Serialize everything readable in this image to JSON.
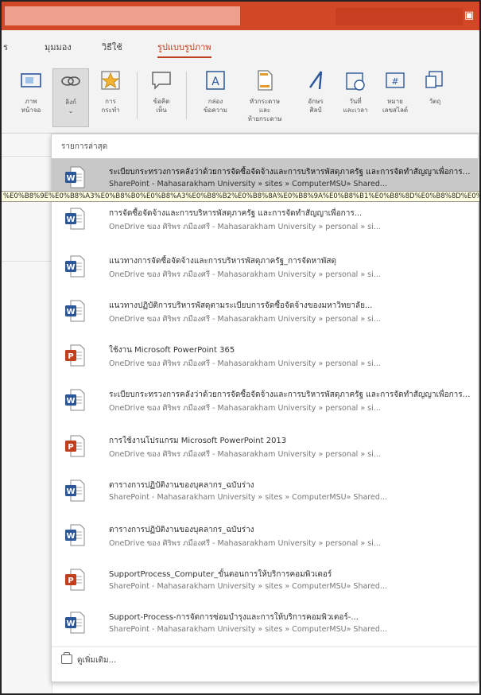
{
  "colors": {
    "accent": "#d24726",
    "word_blue": "#2b579a",
    "powerpoint_red": "#c43e1c",
    "hover_row": "#c8c8c8"
  },
  "ribbon_tabs": [
    {
      "label": "ร"
    },
    {
      "label": "มุมมอง"
    },
    {
      "label": "วิธีใช้"
    },
    {
      "label": "รูปแบบรูปภาพ"
    }
  ],
  "ribbon_buttons": [
    {
      "icon": "screenshot-icon",
      "label": "ภาพ\nหน้าจอ"
    },
    {
      "icon": "link-icon",
      "label": "ลิงก์\n⌄"
    },
    {
      "icon": "action-star-icon",
      "label": "การ\nกระทำ"
    },
    {
      "icon": "comment-icon",
      "label": "ข้อคิด\nเห็น"
    },
    {
      "icon": "textbox-icon",
      "label": "กล่อง\nข้อความ"
    },
    {
      "icon": "header-footer-icon",
      "label": "หัวกระดาษและ\nท้ายกระดาษ"
    },
    {
      "icon": "wordart-icon",
      "label": "อักษร\nศิลป์"
    },
    {
      "icon": "date-time-icon",
      "label": "วันที่\nและเวลา"
    },
    {
      "icon": "slide-number-icon",
      "label": "หมาย\nเลขสไลด์"
    },
    {
      "icon": "object-icon",
      "label": "วัตถุ"
    }
  ],
  "dropdown": {
    "header": "รายการล่าสุด",
    "url_tooltip": "%E0%B8%9E%E0%B8%A3%E0%B8%B0%E0%B8%A3%E0%B8%B2%E0%B8%8A%E0%B8%9A%E0%B8%B1%E0%B8%8D%E0%B8%8D%E0%B8%B1%E0%B8%95%E0%B8%B4%20%E0%B8%9E%E0%B8%A3%E0%B8%B0%E0%B8%A3%E0%B8%B2",
    "items": [
      {
        "type": "word",
        "title": "ระเบียบกระทรวงการคลังว่าด้วยการจัดซื้อจัดจ้างและการบริหารพัสดุภาครัฐ และการจัดทำสัญญาเพื่อการจัดซื้อ...",
        "path": "SharePoint - Mahasarakham University » sites » ComputerMSU» Shared..."
      },
      {
        "type": "word",
        "title": "การจัดซื้อจัดจ้างและการบริหารพัสดุภาครัฐ และการจัดทำสัญญาเพื่อการ...",
        "path": "OneDrive ของ ศิริพร ภมืองศรี - Mahasarakham University » personal » si..."
      },
      {
        "type": "word",
        "title": "แนวทางการจัดซื้อจัดจ้างและการบริหารพัสดุภาครัฐ_การจัดหาพัสดุ",
        "path": "OneDrive ของ ศิริพร ภมืองศรี - Mahasarakham University » personal » si..."
      },
      {
        "type": "word",
        "title": "แนวทางปฏิบัติการบริหารพัสดุตามระเบียบการจัดซื้อจัดจ้างของมหาวิทยาลัย...",
        "path": "OneDrive ของ ศิริพร ภมืองศรี - Mahasarakham University » personal » si..."
      },
      {
        "type": "ppt",
        "title": "ใช้งาน Microsoft PowerPoint 365",
        "path": "OneDrive ของ ศิริพร ภมืองศรี - Mahasarakham University » personal » si..."
      },
      {
        "type": "word",
        "title": "ระเบียบกระทรวงการคลังว่าด้วยการจัดซื้อจัดจ้างและการบริหารพัสดุภาครัฐ และการจัดทำสัญญาเพื่อการจัดซื้อ...",
        "path": "OneDrive ของ ศิริพร ภมืองศรี - Mahasarakham University » personal » si..."
      },
      {
        "type": "ppt",
        "title": "การใช้งานโปรแกรม Microsoft PowerPoint 2013",
        "path": "OneDrive ของ ศิริพร ภมืองศรี - Mahasarakham University » personal » si..."
      },
      {
        "type": "word",
        "title": "ตารางการปฏิบัติงานของบุคลากร_ฉบับร่าง",
        "path": "SharePoint - Mahasarakham University » sites » ComputerMSU» Shared..."
      },
      {
        "type": "word",
        "title": "ตารางการปฏิบัติงานของบุคลากร_ฉบับร่าง",
        "path": "OneDrive ของ ศิริพร ภมืองศรี - Mahasarakham University » personal » si..."
      },
      {
        "type": "ppt",
        "title": "SupportProcess_Computer_ขั้นตอนการให้บริการคอมพิวเตอร์",
        "path": "SharePoint - Mahasarakham University » sites » ComputerMSU» Shared..."
      },
      {
        "type": "word",
        "title": "Support-Process-การจัดการซ่อมบำรุงและการให้บริการคอมพิวเตอร์-...",
        "path": "SharePoint - Mahasarakham University » sites » ComputerMSU» Shared..."
      }
    ],
    "footer_label": "ดูเพิ่มเติม..."
  }
}
